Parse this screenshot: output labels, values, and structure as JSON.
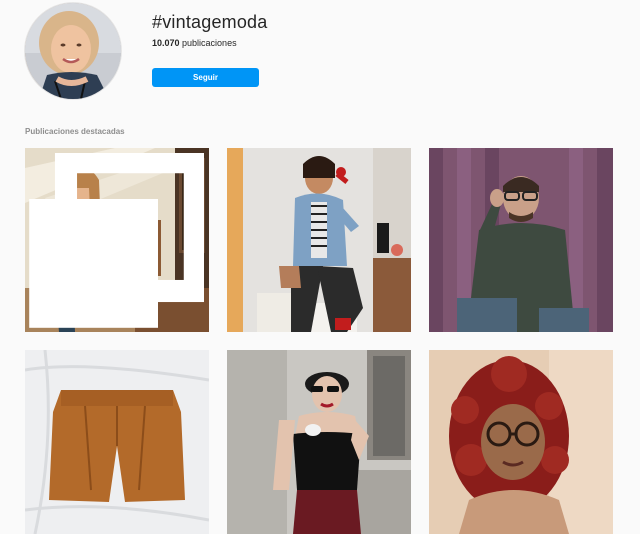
{
  "header": {
    "hashtag": "#vintagemoda",
    "post_count_number": "10.070",
    "post_count_suffix": " publicaciones",
    "follow_label": "Seguir"
  },
  "section": {
    "label": "Publicaciones destacadas"
  },
  "colors": {
    "accent": "#0095f6",
    "background": "#fafafa",
    "muted_text": "#8e8e8e"
  }
}
